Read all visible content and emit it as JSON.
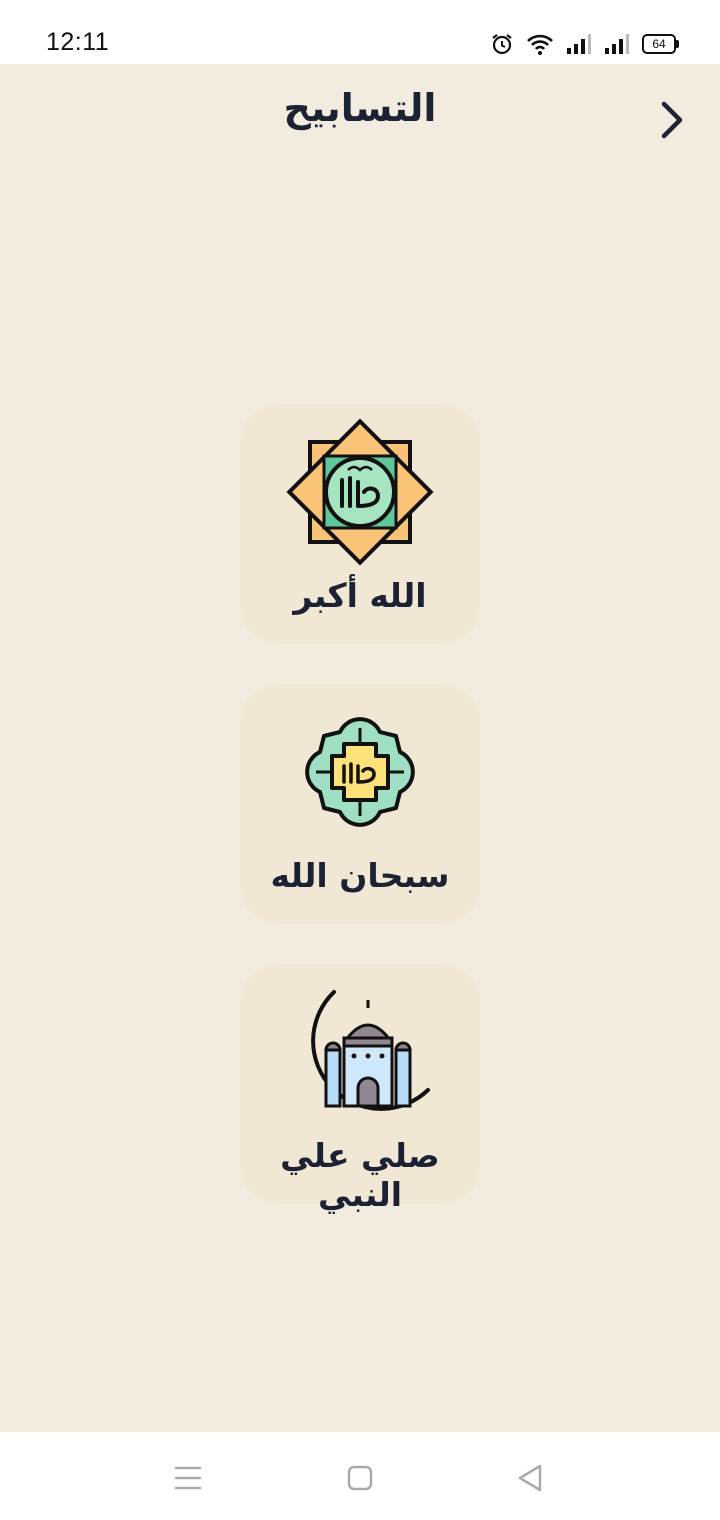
{
  "status_bar": {
    "time": "12:11",
    "battery": "64",
    "icons": [
      "alarm-icon",
      "wifi-icon",
      "signal-icon",
      "signal-icon",
      "battery-icon"
    ]
  },
  "header": {
    "title": "التسابيح",
    "back_icon": "chevron-right-icon"
  },
  "cards": [
    {
      "label": "الله أكبر",
      "icon": "octagram-allah-icon"
    },
    {
      "label": "سبحان الله",
      "icon": "quatrefoil-allah-icon"
    },
    {
      "label": "صلي علي النبي",
      "icon": "crescent-mosque-icon"
    }
  ],
  "colors": {
    "background": "#f1ecdf",
    "card": "#f0e8d4",
    "text": "#1c2233"
  },
  "nav_bar": {
    "icons": [
      "menu-icon",
      "home-square-icon",
      "back-triangle-icon"
    ]
  }
}
